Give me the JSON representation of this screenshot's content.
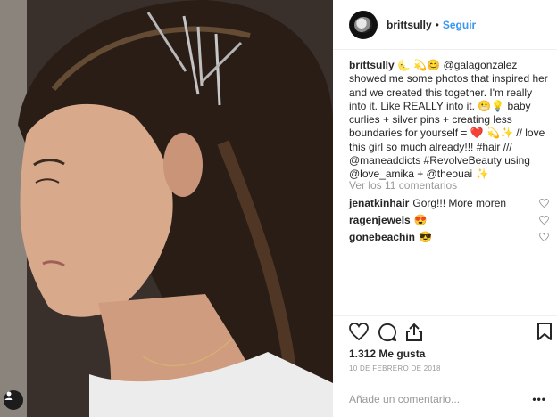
{
  "header": {
    "username": "brittsully",
    "separator": "•",
    "follow_label": "Seguir"
  },
  "caption": {
    "username": "brittsully",
    "text": "🌜 💫😊 @galagonzalez showed me some photos that inspired her and we created this together. I'm really into it. Like REALLY into it. 😬💡 baby curlies + silver pins + creating less boundaries for yourself = ❤️ 💫✨ // love this girl so much already!!! #hair /// @maneaddicts #RevolveBeauty using @love_amika + @theouai ✨"
  },
  "view_comments_label": "Ver los 11 comentarios",
  "comments": [
    {
      "user": "jenatkinhair",
      "text": "Gorg!!! More moren"
    },
    {
      "user": "ragenjewels",
      "text": "😍"
    },
    {
      "user": "gonebeachin",
      "text": "😎"
    }
  ],
  "likes_label": "1.312 Me gusta",
  "date_label": "10 DE FEBRERO DE 2018",
  "add_comment_placeholder": "Añade un comentario...",
  "more_label": "•••",
  "icons": {
    "like": "heart-icon",
    "comment": "comment-icon",
    "share": "share-icon",
    "save": "bookmark-icon",
    "comment_like": "heart-outline-icon",
    "photo_account": "person-icon"
  },
  "colors": {
    "link": "#3897f0",
    "muted": "#999999",
    "text": "#262626"
  }
}
